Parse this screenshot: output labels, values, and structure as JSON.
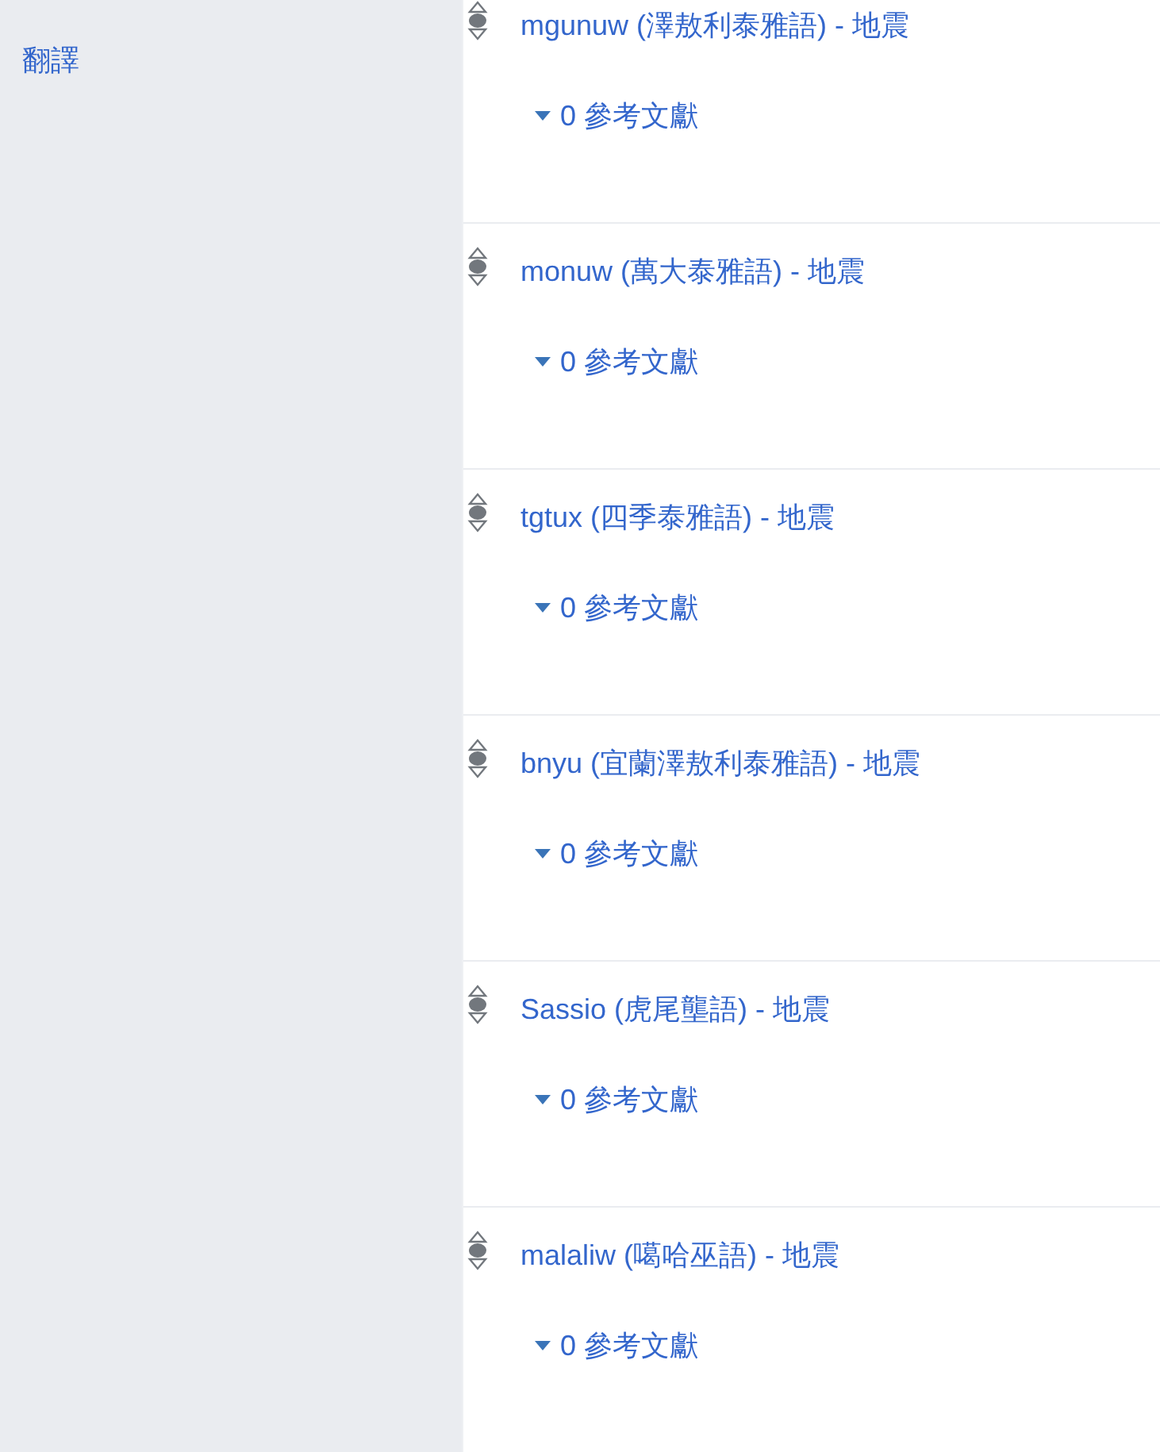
{
  "sidebar": {
    "heading": "翻譯"
  },
  "sitelinks": [
    {
      "title": "mgunuw (澤敖利泰雅語) - 地震",
      "references": "0 參考文獻"
    },
    {
      "title": "monuw (萬大泰雅語) - 地震",
      "references": "0 參考文獻"
    },
    {
      "title": "tgtux (四季泰雅語) - 地震",
      "references": "0 參考文獻"
    },
    {
      "title": "bnyu (宜蘭澤敖利泰雅語) - 地震",
      "references": "0 參考文獻"
    },
    {
      "title": "Sassio (虎尾壟語) - 地震",
      "references": "0 參考文獻"
    },
    {
      "title": "malaliw (噶哈巫語) - 地震",
      "references": "0 參考文獻"
    }
  ]
}
